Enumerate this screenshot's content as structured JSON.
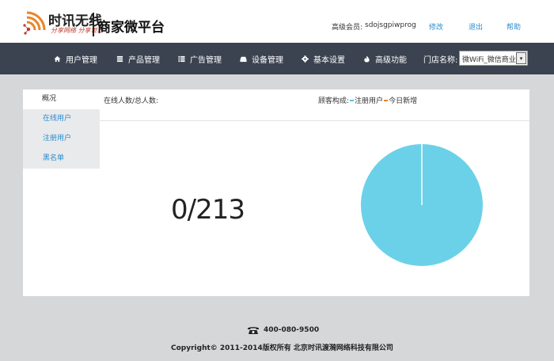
{
  "brand": {
    "name": "时讯无线",
    "slogan": "分享网络  分享世界",
    "platform": "商家微平台",
    "accent": "#e8862a"
  },
  "user": {
    "label": "高级会员:",
    "name": "sdojsgpiwprog",
    "edit": "修改",
    "logout": "退出",
    "help": "帮助"
  },
  "nav": {
    "items": [
      {
        "label": "用户管理",
        "icon": "home-icon"
      },
      {
        "label": "产品管理",
        "icon": "list-icon"
      },
      {
        "label": "广告管理",
        "icon": "th-list-icon"
      },
      {
        "label": "设备管理",
        "icon": "hdd-icon"
      },
      {
        "label": "基本设置",
        "icon": "cog-icon"
      },
      {
        "label": "高级功能",
        "icon": "fire-icon"
      }
    ],
    "store_label": "门店名称:",
    "store_value": "微WiFi_微信商业",
    "bg": "#3b4350"
  },
  "sidebar": {
    "overview": "概况",
    "items": [
      "在线用户",
      "注册用户",
      "黑名单"
    ]
  },
  "stats": {
    "label": "在线人数/总人数:",
    "value": "0/213",
    "legend_title": "顾客构成:",
    "legend": [
      {
        "label": "注册用户",
        "color": "#5bc0de"
      },
      {
        "label": "今日新增",
        "color": "#e8862a"
      }
    ]
  },
  "chart_data": {
    "type": "pie",
    "slices": [
      {
        "label": "注册用户",
        "value": 213,
        "color": "#6bd1e8"
      },
      {
        "label": "今日新增",
        "value": 0,
        "color": "#e8862a"
      }
    ]
  },
  "footer": {
    "phone": "400-080-9500",
    "copyright": "Copyright© 2011-2014版权所有 北京时讯渡漪网络科技有限公司"
  }
}
